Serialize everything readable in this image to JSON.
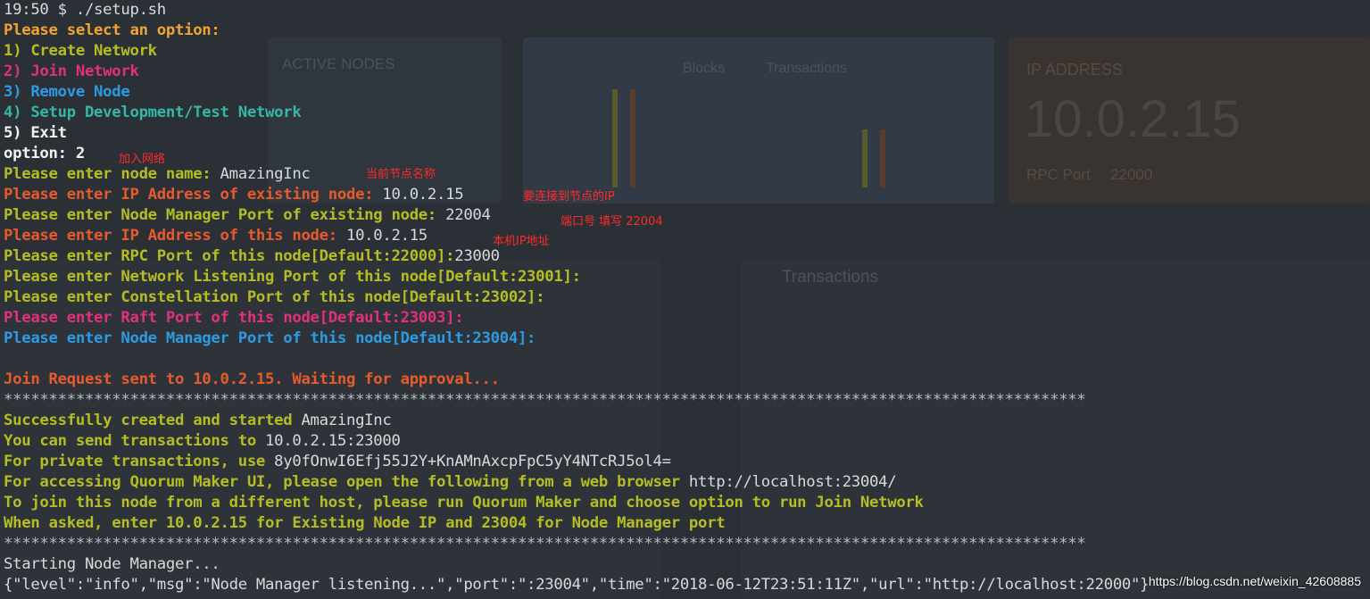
{
  "background_dashboard": {
    "card1_title": "ACTIVE NODES",
    "card2_legend": [
      "Blocks",
      "Transactions"
    ],
    "card3_title": "IP ADDRESS",
    "card3_value": "10.0.2.15",
    "card3_sub": "RPC Port",
    "card3_port": "22000",
    "panel_title": "Transactions"
  },
  "terminal": {
    "prompt": "19:50 $ ./setup.sh",
    "menu_title": "Please select an option:",
    "menu": {
      "opt1": "1) Create Network",
      "opt2": "2) Join Network",
      "opt3": "3) Remove Node",
      "opt4": "4) Setup Development/Test Network",
      "opt5": "5) Exit"
    },
    "option_line": "option: 2",
    "node_name_prompt": "Please enter node name: ",
    "node_name_value": "AmazingInc",
    "existing_ip_prompt": "Please enter IP Address of existing node: ",
    "existing_ip_value": "10.0.2.15",
    "nm_port_prompt": "Please enter Node Manager Port of existing node: ",
    "nm_port_value": "22004",
    "this_ip_prompt": "Please enter IP Address of this node: ",
    "this_ip_value": "10.0.2.15",
    "rpc_prompt": "Please enter RPC Port of this node[Default:22000]:",
    "rpc_value": "23000",
    "listen_prompt": "Please enter Network Listening Port of this node[Default:23001]:",
    "constellation_prompt": "Please enter Constellation Port of this node[Default:23002]:",
    "raft_prompt": "Please enter Raft Port of this node[Default:23003]:",
    "nm_this_prompt": "Please enter Node Manager Port of this node[Default:23004]:",
    "join_sent": "Join Request sent to 10.0.2.15. Waiting for approval...",
    "stars": "************************************************************************************************************************",
    "created_label": "Successfully created and started ",
    "created_value": "AmazingInc",
    "send_label": "You can send transactions to ",
    "send_value": "10.0.2.15:23000",
    "private_label": "For private transactions, use ",
    "private_value": "8y0fOnwI6Efj55J2Y+KnAMnAxcpFpC5yY4NTcRJ5ol4=",
    "ui_label": "For accessing Quorum Maker UI, please open the following from a web browser ",
    "ui_value": "http://localhost:23004/",
    "join_hint": "To join this node from a different host, please run Quorum Maker and choose option to run Join Network",
    "asked_hint": "When asked, enter 10.0.2.15 for Existing Node IP and 23004 for Node Manager port",
    "starting": "Starting Node Manager...",
    "log_line": "{\"level\":\"info\",\"msg\":\"Node Manager listening...\",\"port\":\":23004\",\"time\":\"2018-06-12T23:51:11Z\",\"url\":\"http://localhost:22000\"}"
  },
  "annotations": {
    "join_network": "加入网络",
    "node_name": "当前节点名称",
    "existing_node": "要连接到节点的IP",
    "port": "端口号 填写 22004",
    "local_ip": "本机IP地址"
  },
  "watermark": "https://blog.csdn.net/weixin_42608885",
  "colors": {
    "background": "#2b3036",
    "yellow": "#b5bd22",
    "orange": "#f0a431",
    "red": "#e75a2c",
    "pink": "#e0317c",
    "blue": "#2c9be1",
    "teal": "#35b7a6",
    "annotation": "#ff2a2a"
  }
}
